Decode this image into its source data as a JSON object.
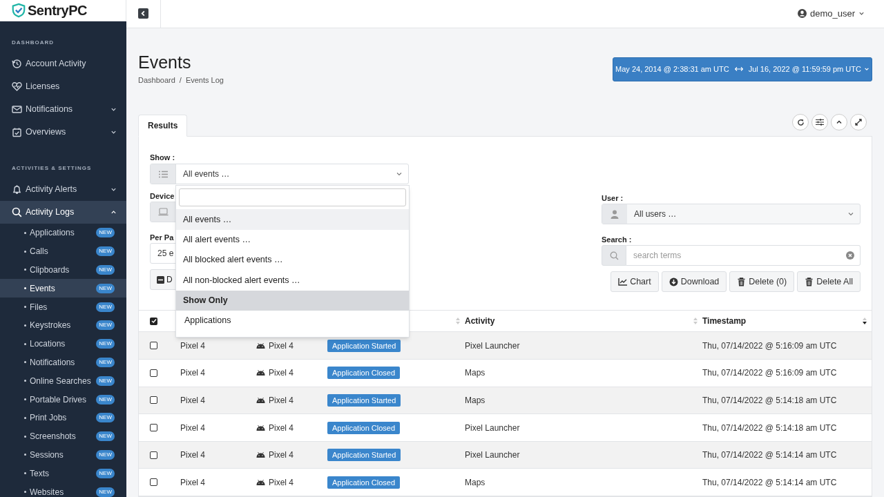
{
  "brand": "SentryPC",
  "sidebar": {
    "sections": [
      {
        "heading": "DASHBOARD",
        "items": [
          {
            "label": "Account Activity",
            "kind": "link",
            "selected": false
          },
          {
            "label": "Licenses",
            "kind": "link",
            "selected": false
          },
          {
            "label": "Notifications",
            "kind": "group",
            "expanded": false,
            "selected": false
          },
          {
            "label": "Overviews",
            "kind": "group",
            "expanded": false,
            "selected": false
          }
        ]
      },
      {
        "heading": "ACTIVITIES & SETTINGS",
        "items": [
          {
            "label": "Activity Alerts",
            "kind": "group",
            "expanded": false,
            "selected": false
          },
          {
            "label": "Activity Logs",
            "kind": "group",
            "expanded": true,
            "selected": true,
            "children": [
              {
                "label": "Applications",
                "badge": "NEW",
                "selected": false
              },
              {
                "label": "Calls",
                "badge": "NEW",
                "selected": false
              },
              {
                "label": "Clipboards",
                "badge": "NEW",
                "selected": false
              },
              {
                "label": "Events",
                "badge": "NEW",
                "selected": true
              },
              {
                "label": "Files",
                "badge": "NEW",
                "selected": false
              },
              {
                "label": "Keystrokes",
                "badge": "NEW",
                "selected": false
              },
              {
                "label": "Locations",
                "badge": "NEW",
                "selected": false
              },
              {
                "label": "Notifications",
                "badge": "NEW",
                "selected": false
              },
              {
                "label": "Online Searches",
                "badge": "NEW",
                "selected": false
              },
              {
                "label": "Portable Drives",
                "badge": "NEW",
                "selected": false
              },
              {
                "label": "Print Jobs",
                "badge": "NEW",
                "selected": false
              },
              {
                "label": "Screenshots",
                "badge": "NEW",
                "selected": false
              },
              {
                "label": "Sessions",
                "badge": "NEW",
                "selected": false
              },
              {
                "label": "Texts",
                "badge": "NEW",
                "selected": false
              },
              {
                "label": "Websites",
                "badge": "NEW",
                "selected": false
              }
            ]
          }
        ]
      }
    ]
  },
  "topbar": {
    "user": "demo_user"
  },
  "page": {
    "title": "Events",
    "breadcrumb": [
      "Dashboard",
      "/",
      "Events Log"
    ]
  },
  "date_range": {
    "start": "May 24, 2014 @ 2:38:31 am UTC",
    "end": "Jul 16, 2022 @ 11:59:59 pm UTC"
  },
  "tabs": [
    {
      "label": "Results",
      "selected": true
    }
  ],
  "filters": {
    "show": {
      "label": "Show :",
      "value": "All events …"
    },
    "device": {
      "label": "Device"
    },
    "per_page": {
      "label": "Per Pa",
      "value": "25 e"
    },
    "left_button": "D",
    "user": {
      "label": "User :",
      "value": "All users …"
    },
    "search": {
      "label": "Search :",
      "placeholder": "search terms"
    }
  },
  "actions": [
    "Chart",
    "Download",
    "Delete (0)",
    "Delete All"
  ],
  "dropdown": {
    "options": [
      {
        "label": "All events …",
        "selected": true
      },
      {
        "label": "All alert events …",
        "selected": false
      },
      {
        "label": "All blocked alert events …",
        "selected": false
      },
      {
        "label": "All non-blocked alert events …",
        "selected": false
      }
    ],
    "group": "Show Only",
    "group_items": [
      "Applications"
    ]
  },
  "table": {
    "select_all": true,
    "columns": [
      {
        "sorted": false
      },
      {
        "label": "Activity",
        "sorted": false
      },
      {
        "label": "Timestamp",
        "sorted": true
      }
    ],
    "rows": [
      {
        "checked": false,
        "device": "Pixel 4",
        "user": "Pixel 4",
        "event": "Application Started",
        "activity": "Pixel Launcher",
        "timestamp": "Thu, 07/14/2022 @ 5:16:09 am UTC"
      },
      {
        "checked": false,
        "device": "Pixel 4",
        "user": "Pixel 4",
        "event": "Application Closed",
        "activity": "Maps",
        "timestamp": "Thu, 07/14/2022 @ 5:16:09 am UTC"
      },
      {
        "checked": false,
        "device": "Pixel 4",
        "user": "Pixel 4",
        "event": "Application Started",
        "activity": "Maps",
        "timestamp": "Thu, 07/14/2022 @ 5:14:18 am UTC"
      },
      {
        "checked": false,
        "device": "Pixel 4",
        "user": "Pixel 4",
        "event": "Application Closed",
        "activity": "Pixel Launcher",
        "timestamp": "Thu, 07/14/2022 @ 5:14:18 am UTC"
      },
      {
        "checked": false,
        "device": "Pixel 4",
        "user": "Pixel 4",
        "event": "Application Started",
        "activity": "Pixel Launcher",
        "timestamp": "Thu, 07/14/2022 @ 5:14:14 am UTC"
      },
      {
        "checked": false,
        "device": "Pixel 4",
        "user": "Pixel 4",
        "event": "Application Closed",
        "activity": "Maps",
        "timestamp": "Thu, 07/14/2022 @ 5:14:14 am UTC"
      }
    ]
  }
}
